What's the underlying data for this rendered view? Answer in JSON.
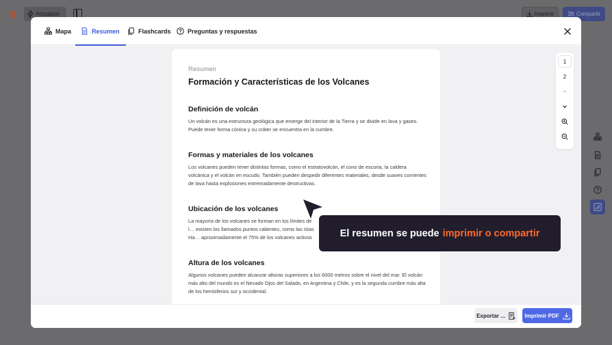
{
  "app_bar": {
    "update_label": "Actualizar",
    "print_label": "Imprimir",
    "share_label": "Compartir"
  },
  "modal": {
    "tabs": [
      {
        "label": "Mapa",
        "icon": "map-icon"
      },
      {
        "label": "Resumen",
        "icon": "document-icon",
        "active": true
      },
      {
        "label": "Flashcards",
        "icon": "cards-icon"
      },
      {
        "label": "Preguntas y respuestas",
        "icon": "question-icon"
      }
    ],
    "close_icon": "close-icon"
  },
  "document": {
    "kicker": "Resumen",
    "title": "Formación y Características de los Volcanes",
    "sections": [
      {
        "heading": "Definición de volcán",
        "body": "Un volcán es una estructura geológica que emerge del interior de la Tierra y se divide en lava y gases. Puede tener forma cónica y su cráter se encuentra en la cumbre."
      },
      {
        "heading": "Formas y materiales de los volcanes",
        "body": "Los volcanes pueden tener distintas formas, como el estratovolcán, el cono de escoria, la caldera volcánica y el volcán en escudo. También pueden despedir diferentes materiales, desde suaves corrientes de lava hasta explosiones extremadamente destructivas."
      },
      {
        "heading": "Ubicación de los volcanes",
        "body": "La mayoría de los volcanes se forman en los límites de l… existen los llamados puntos calientes, como las islas Ha… aproximadamente el 75% de los volcanes activos del m…"
      },
      {
        "heading": "Altura de los volcanes",
        "body": "Algunos volcanes pueden alcanzar alturas superiores a los 6000 metros sobre el nivel del mar. El volcán más alto del mundo es el Nevado Ojos del Salado, en Argentina y Chile, y es la segunda cumbre más alta de los hemisferios sur y occidental."
      }
    ]
  },
  "pager": {
    "pages": [
      "1",
      "2"
    ],
    "current": "1"
  },
  "footer": {
    "export_label": "Exportar ...",
    "print_pdf_label": "Imprimir PDF"
  },
  "hint": {
    "prefix": "El resumen se puede",
    "highlight": "imprimir o compartir"
  },
  "colors": {
    "accent": "#3e5bd9",
    "primary_button": "#4f69e6",
    "hint_bg": "#211d2c",
    "hint_accent": "#ff6a2c"
  }
}
